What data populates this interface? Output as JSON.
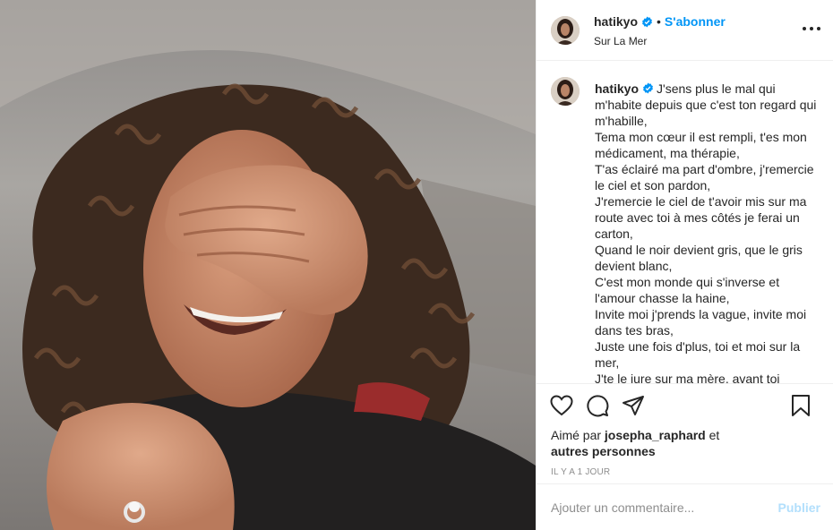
{
  "post": {
    "photo_alt_icon": "selfie-photo",
    "author": {
      "username": "hatikyo",
      "verified_icon": "verified-badge-icon",
      "separator": "•",
      "follow_label": "S'abonner",
      "location": "Sur La Mer"
    },
    "caption": {
      "username": "hatikyo",
      "lines": [
        "J'sens plus le mal qui m'habite depuis que c'est ton regard qui m'habille,",
        "Tema mon cœur il est rempli, t'es mon médicament, ma thérapie,",
        "T'as éclairé ma part d'ombre, j'remercie le ciel et son pardon,",
        "J'remercie le ciel de t'avoir mis sur ma route avec toi à mes côtés je ferai un carton,",
        "Quand le noir devient gris, que le gris devient blanc,",
        "C'est mon monde qui s'inverse et l'amour chasse la haine,",
        "Invite moi j'prends la vague, invite moi dans tes bras,",
        "Juste une fois d'plus, toi et moi sur la mer,",
        "J'te le jure sur ma mère, avant toi"
      ]
    },
    "likes": {
      "prefix": "Aimé par",
      "user": "josepha_raphard",
      "connector": "et",
      "others": "autres personnes"
    },
    "timestamp": "Il y a 1 jour",
    "comment": {
      "placeholder": "Ajouter un commentaire...",
      "publish_label": "Publier"
    }
  },
  "colors": {
    "accent": "#0095f6",
    "publish_disabled": "#b2dffc",
    "muted": "#8e8e8e",
    "text": "#262626",
    "border": "#efefef"
  }
}
